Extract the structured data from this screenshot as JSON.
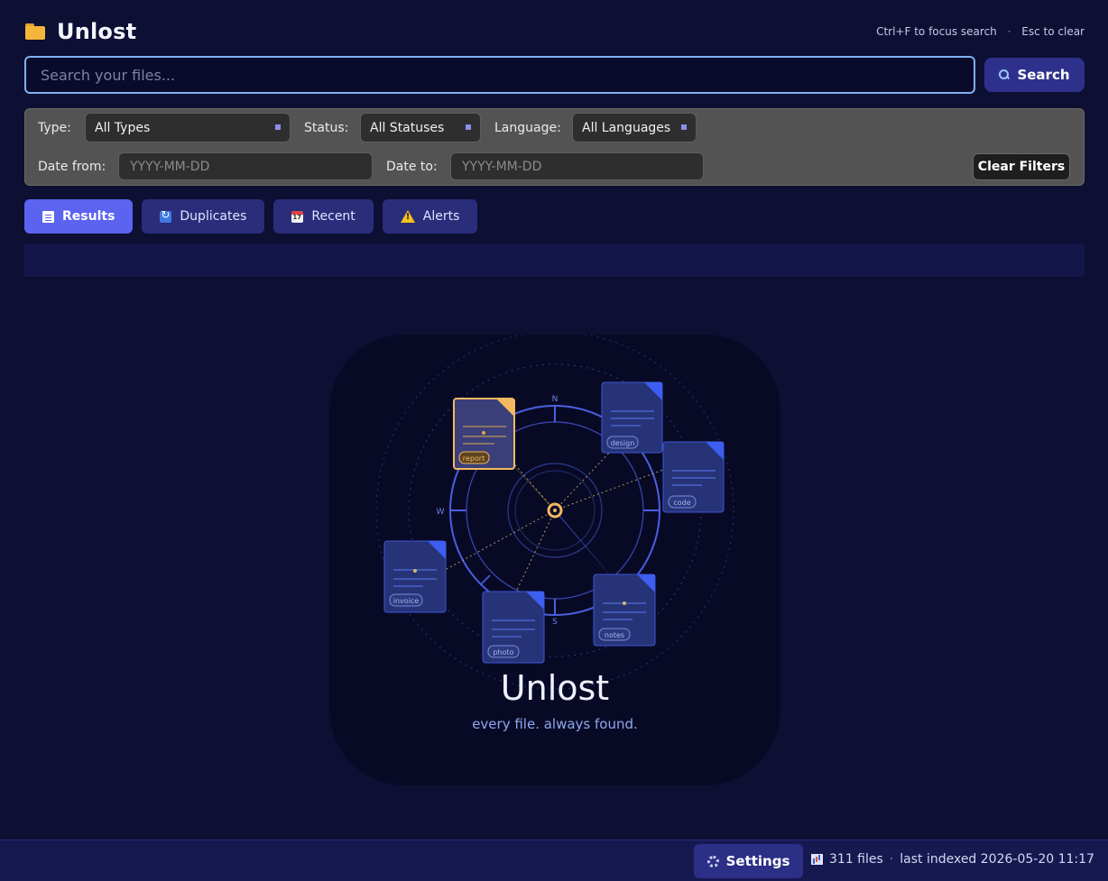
{
  "app": {
    "title": "Unlost",
    "icon": "folder-icon"
  },
  "shortcuts": {
    "focus_key": "Ctrl+F",
    "focus_text": "to focus search",
    "separator": "·",
    "clear_key": "Esc",
    "clear_text": "to clear"
  },
  "search": {
    "placeholder": "Search your files...",
    "value": "",
    "button_label": "Search",
    "button_icon": "magnifier-icon"
  },
  "filters": {
    "type_label": "Type:",
    "type_value": "All Types",
    "status_label": "Status:",
    "status_value": "All Statuses",
    "language_label": "Language:",
    "language_value": "All Languages",
    "date_from_label": "Date from:",
    "date_from_placeholder": "YYYY-MM-DD",
    "date_to_label": "Date to:",
    "date_to_placeholder": "YYYY-MM-DD",
    "clear_label": "Clear Filters"
  },
  "tabs": [
    {
      "label": "Results",
      "icon": "document-icon",
      "active": true
    },
    {
      "label": "Duplicates",
      "icon": "refresh-icon",
      "active": false
    },
    {
      "label": "Recent",
      "icon": "calendar-icon",
      "active": false
    },
    {
      "label": "Alerts",
      "icon": "warning-icon",
      "active": false
    }
  ],
  "hero": {
    "title": "Unlost",
    "tagline": "every file. always found.",
    "compass": {
      "n": "N",
      "s": "S",
      "w": "W"
    },
    "cards": [
      "report",
      "design",
      "code",
      "invoice",
      "photo",
      "notes"
    ]
  },
  "colors": {
    "accent": "#5b63f0",
    "highlight": "#f4b860",
    "background": "#0d0f33",
    "card": "#263377"
  },
  "status": {
    "settings_label": "Settings",
    "files": "311 files",
    "separator": "·",
    "last_indexed": "last indexed 2026-05-20 11:17"
  }
}
